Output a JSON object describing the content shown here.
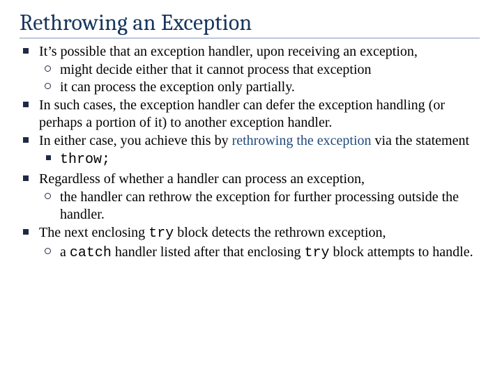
{
  "title": "Rethrowing an Exception",
  "b1": {
    "text": "It’s possible that an exception handler, upon receiving an exception,",
    "sub": [
      "might decide either that it cannot process that exception",
      "it can process the exception only partially."
    ]
  },
  "b2": "In such cases, the exception handler can defer the exception handling (or perhaps a portion of it) to another exception handler.",
  "b3": {
    "pre": "In either case, you achieve this by ",
    "hl": "rethrowing the exception ",
    "post": "via the statement",
    "code": "throw;"
  },
  "b4": {
    "text": "Regardless of whether a handler can process an exception,",
    "sub": "the handler can rethrow the exception for further processing outside the handler."
  },
  "b5": {
    "p1": "The next enclosing ",
    "c1": "try",
    "p2": " block detects the rethrown exception,",
    "sub_p1": "a ",
    "sub_c1": "catch",
    "sub_p2": " handler listed after that enclosing ",
    "sub_c2": "try",
    "sub_p3": " block attempts to handle."
  },
  "chart_data": null
}
